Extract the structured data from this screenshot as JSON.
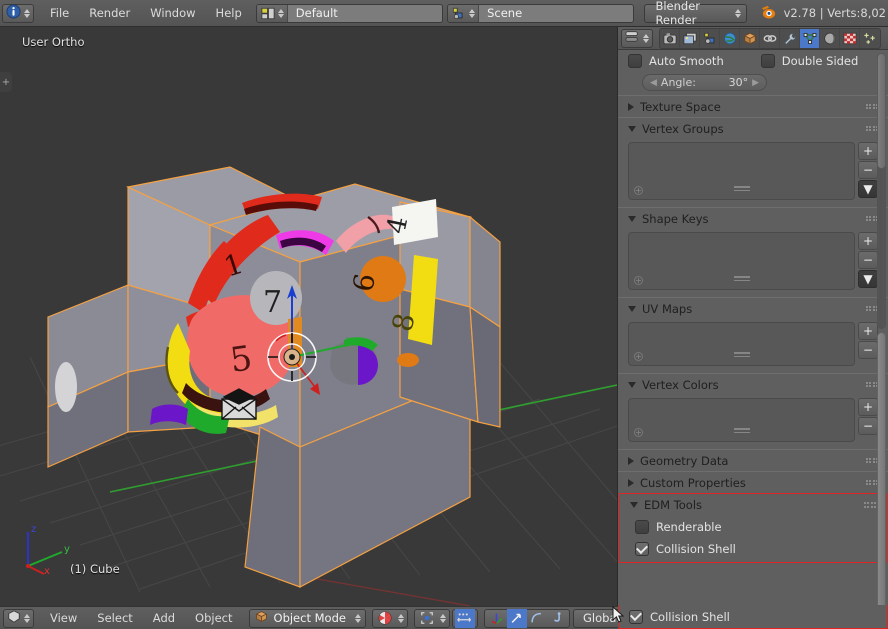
{
  "topbar": {
    "editor_icon": "info-editor-icon",
    "menus": [
      "File",
      "Render",
      "Window",
      "Help"
    ],
    "screen_layout": {
      "icon": "screen-layout-icon",
      "value": "Default",
      "add_label": "+",
      "remove_label": "×"
    },
    "scene": {
      "icon": "scene-icon",
      "value": "Scene",
      "add_label": "+",
      "remove_label": "×"
    },
    "engine": {
      "value": "Blender Render",
      "icon": "chevron-updown-icon"
    },
    "version_info": "v2.78 | Verts:8,02"
  },
  "viewport": {
    "view_label": "User Ortho",
    "object_label": "(1) Cube",
    "axis": {
      "x": "x",
      "y": "y",
      "z": "z"
    },
    "colors": {
      "background": "#393939",
      "grid": "#4c4c4c",
      "y_axis": "#29a329",
      "x_axis": "#a32929",
      "selected_outline": "#f5a142",
      "mesh_face_light": "#9a9aa6",
      "mesh_face_mid": "#7f7f8b",
      "mesh_face_dark": "#5d5d68"
    },
    "decals": [
      "1",
      "7",
      "5",
      "6",
      "4",
      "8"
    ]
  },
  "properties": {
    "editor_icon": "properties-editor-icon",
    "tabs": [
      {
        "name": "render-tab",
        "icon": "camera-icon",
        "active": false
      },
      {
        "name": "render-layers-tab",
        "icon": "images-icon",
        "active": false
      },
      {
        "name": "scene-tab",
        "icon": "scene-icon",
        "active": false
      },
      {
        "name": "world-tab",
        "icon": "world-icon",
        "active": false
      },
      {
        "name": "object-tab",
        "icon": "cube-icon",
        "active": false
      },
      {
        "name": "constraints-tab",
        "icon": "chain-icon",
        "active": false
      },
      {
        "name": "modifiers-tab",
        "icon": "wrench-icon",
        "active": false
      },
      {
        "name": "object-data-tab",
        "icon": "mesh-data-icon",
        "active": true
      },
      {
        "name": "material-tab",
        "icon": "sphere-icon",
        "active": false
      },
      {
        "name": "texture-tab",
        "icon": "checker-icon",
        "active": false
      },
      {
        "name": "particles-tab",
        "icon": "particles-icon",
        "active": false
      }
    ],
    "normals": {
      "auto_smooth": {
        "label": "Auto Smooth",
        "checked": false
      },
      "double_sided": {
        "label": "Double Sided",
        "checked": false
      },
      "angle": {
        "label": "Angle:",
        "value": "30°"
      }
    },
    "panels": [
      {
        "title": "Texture Space",
        "open": false,
        "type": "header"
      },
      {
        "title": "Vertex Groups",
        "open": true,
        "type": "list",
        "buttons": [
          "+",
          "−",
          "▼"
        ]
      },
      {
        "title": "Shape Keys",
        "open": true,
        "type": "list",
        "buttons": [
          "+",
          "−",
          "▼"
        ]
      },
      {
        "title": "UV Maps",
        "open": true,
        "type": "list",
        "buttons": [
          "+",
          "−"
        ]
      },
      {
        "title": "Vertex Colors",
        "open": true,
        "type": "list",
        "buttons": [
          "+",
          "−"
        ]
      },
      {
        "title": "Geometry Data",
        "open": false,
        "type": "header"
      },
      {
        "title": "Custom Properties",
        "open": false,
        "type": "header"
      }
    ],
    "edm_tools": {
      "title": "EDM Tools",
      "open": true,
      "highlight_color": "#e02424",
      "renderable": {
        "label": "Renderable",
        "checked": false
      },
      "collision_shell": {
        "label": "Collision Shell",
        "checked": true
      }
    }
  },
  "bottombar": {
    "editor_icon": "3d-view-editor-icon",
    "menus": [
      "View",
      "Select",
      "Add",
      "Object"
    ],
    "mode": {
      "icon": "object-mode-icon",
      "value": "Object Mode"
    },
    "shading": {
      "icon": "solid-shading-icon"
    },
    "pivot": {
      "icon": "pivot-point-icon"
    },
    "snap": {
      "icon": "snap-magnet-icon"
    },
    "manipulators": [
      {
        "name": "translate-manipulator",
        "icon": "axis-icon",
        "active": false
      },
      {
        "name": "rotate-manipulator",
        "icon": "arrow-icon",
        "active": true
      },
      {
        "name": "scale-manipulator",
        "icon": "arc-icon",
        "active": false
      },
      {
        "name": "extra-manipulator",
        "icon": "hook-icon",
        "active": false
      }
    ],
    "orientation": {
      "value": "Global"
    }
  }
}
